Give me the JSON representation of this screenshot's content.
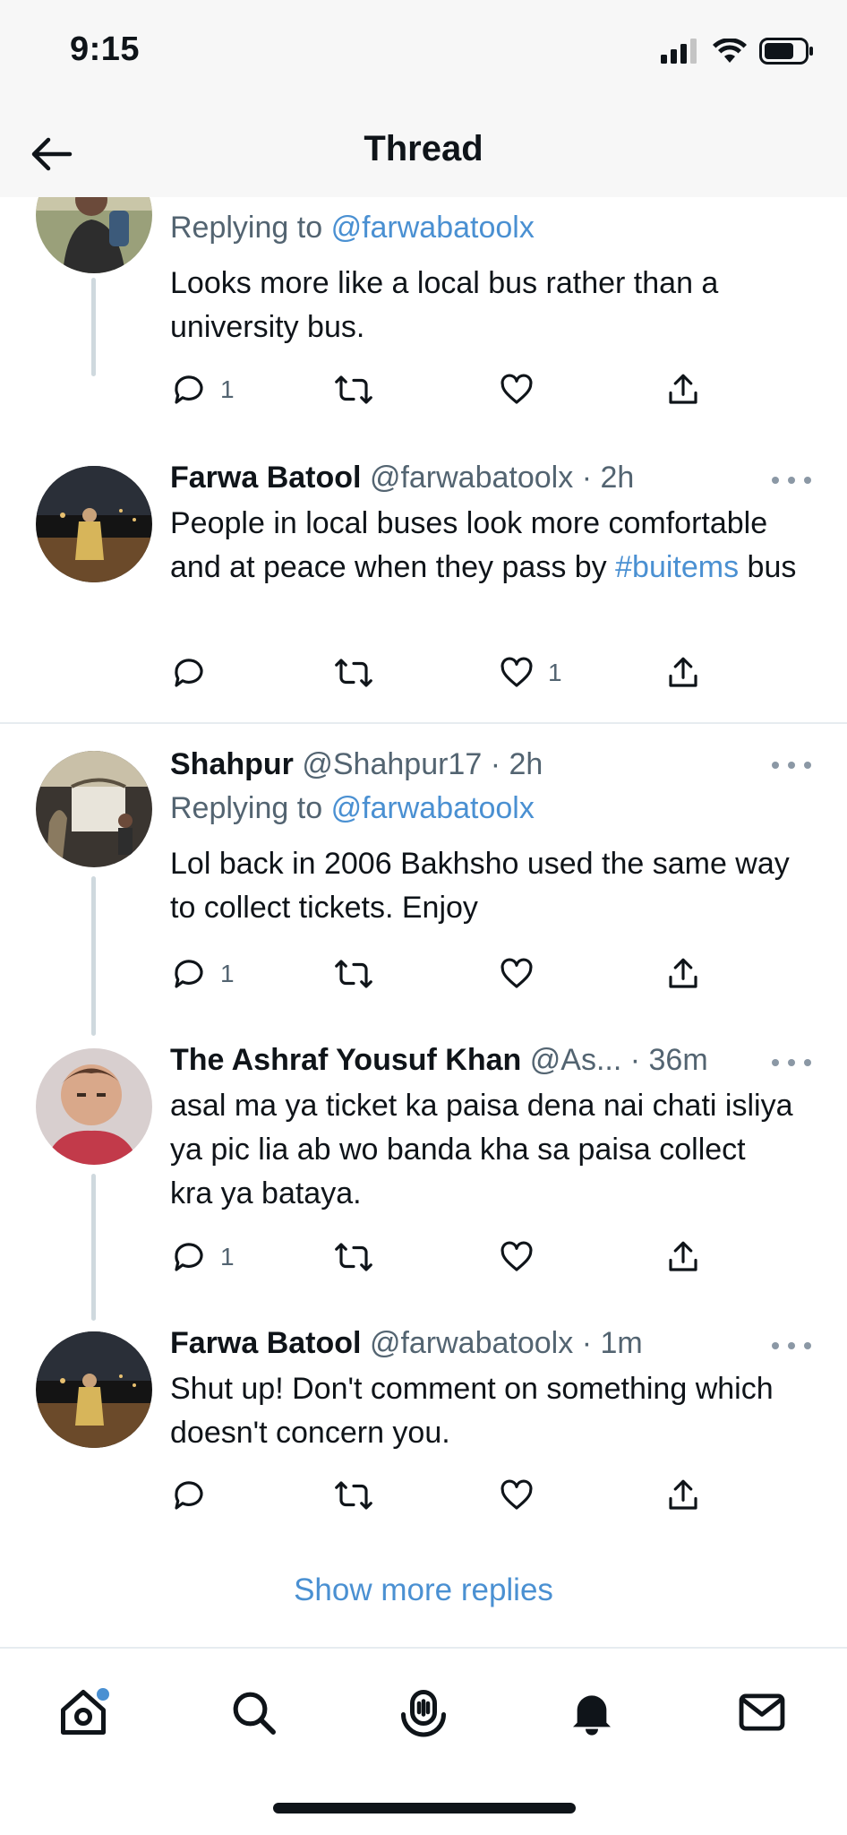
{
  "status_bar": {
    "time": "9:15"
  },
  "header": {
    "title": "Thread"
  },
  "tweets": [
    {
      "name": "",
      "handle": "",
      "time": "",
      "replying_label": "Replying to",
      "replying_to": "@farwabatoolx",
      "text": "Looks more like a local bus rather than a university bus.",
      "replies": "1",
      "retweets": "",
      "likes": ""
    },
    {
      "name": "Farwa Batool",
      "handle": "@farwabatoolx",
      "time": "· 2h",
      "text_before": "People in local buses look more comfortable and at peace when they pass by ",
      "hashtag": "#buitems",
      "text_after": " bus",
      "replies": "",
      "retweets": "",
      "likes": "1"
    },
    {
      "name": "Shahpur",
      "handle": "@Shahpur17",
      "time": "· 2h",
      "replying_label": "Replying to",
      "replying_to": "@farwabatoolx",
      "text": "Lol back in 2006 Bakhsho used the same way to collect tickets. Enjoy",
      "replies": "1",
      "retweets": "",
      "likes": ""
    },
    {
      "name": "The Ashraf Yousuf Khan",
      "handle": "@As...",
      "time": "· 36m",
      "text": "asal ma ya ticket ka paisa dena nai chati isliya ya pic lia ab wo banda kha sa paisa collect kra ya bataya.",
      "replies": "1",
      "retweets": "",
      "likes": ""
    },
    {
      "name": "Farwa Batool",
      "handle": "@farwabatoolx",
      "time": "· 1m",
      "text": "Shut up! Don't comment on something which doesn't concern you.",
      "replies": "",
      "retweets": "",
      "likes": ""
    }
  ],
  "show_more": "Show more replies",
  "tab_bar": {
    "items": [
      "home-icon",
      "search-icon",
      "spaces-icon",
      "notifications-icon",
      "messages-icon"
    ],
    "accent": "#4a90d2"
  },
  "colors": {
    "link": "#4a90d2",
    "meta": "#536471",
    "text": "#0f1419"
  }
}
